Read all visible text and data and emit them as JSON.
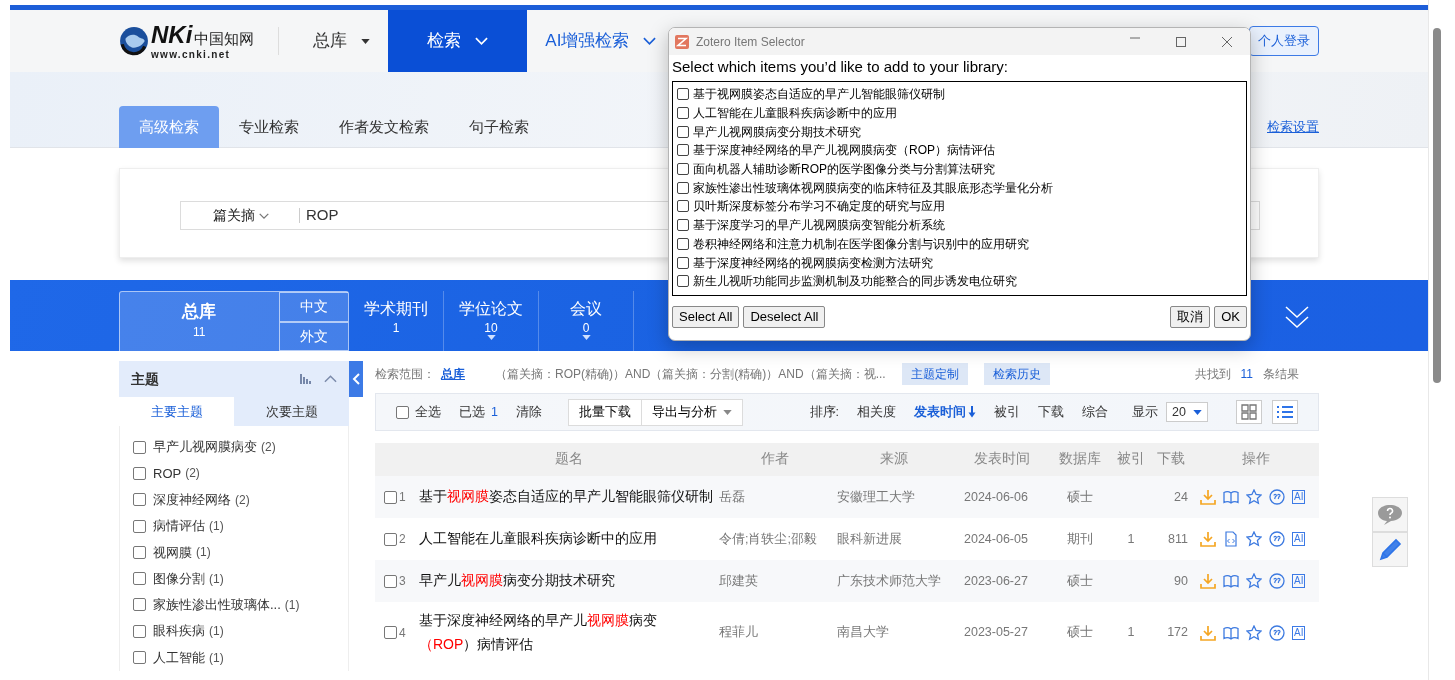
{
  "header": {
    "logo": {
      "mark": "NKi",
      "name": "中国知网",
      "url": "www.cnki.net"
    },
    "nav": [
      {
        "label": "总库",
        "kind": "dropdown",
        "selected": false
      },
      {
        "label": "检索",
        "kind": "menu",
        "selected": true
      },
      {
        "label": "AI增强检索",
        "kind": "menu",
        "selected": false
      }
    ],
    "login_button": "个人登录"
  },
  "search_tabs": [
    {
      "label": "高级检索",
      "selected": true
    },
    {
      "label": "专业检索",
      "selected": false
    },
    {
      "label": "作者发文检索",
      "selected": false
    },
    {
      "label": "句子检索",
      "selected": false
    }
  ],
  "search_settings_link": "检索设置",
  "search_row": {
    "field": "篇关摘",
    "value": "ROP"
  },
  "databases": {
    "all": {
      "label": "总库",
      "count": "11",
      "selected": true
    },
    "languages": [
      {
        "label": "中文"
      },
      {
        "label": "外文"
      }
    ],
    "items": [
      {
        "label": "学术期刊",
        "count": "1",
        "expandable": false
      },
      {
        "label": "学位论文",
        "count": "10",
        "expandable": true
      },
      {
        "label": "会议",
        "count": "0",
        "expandable": true
      }
    ]
  },
  "sidebar": {
    "title": "主题",
    "subtabs": [
      {
        "label": "主要主题",
        "selected": true
      },
      {
        "label": "次要主题",
        "selected": false
      }
    ],
    "items": [
      {
        "label": "早产儿视网膜病变",
        "count": "(2)",
        "checked": false
      },
      {
        "label": "ROP",
        "count": "(2)",
        "checked": false
      },
      {
        "label": "深度神经网络",
        "count": "(2)",
        "checked": false
      },
      {
        "label": "病情评估",
        "count": "(1)",
        "checked": false
      },
      {
        "label": "视网膜",
        "count": "(1)",
        "checked": false
      },
      {
        "label": "图像分割",
        "count": "(1)",
        "checked": false
      },
      {
        "label": "家族性渗出性玻璃体...",
        "count": "(1)",
        "checked": false
      },
      {
        "label": "眼科疾病",
        "count": "(1)",
        "checked": false
      },
      {
        "label": "人工智能",
        "count": "(1)",
        "checked": false
      }
    ]
  },
  "results": {
    "scope_label": "检索范围：",
    "scope": "总库",
    "query": "（篇关摘：ROP(精确)）AND（篇关摘：分割(精确)）AND（篇关摘：视...",
    "topic_button": "主题定制",
    "history_button": "检索历史",
    "found_prefix": "共找到",
    "found_count": "11",
    "found_suffix": "条结果",
    "toolbar": {
      "select_all": {
        "label": "全选",
        "checked": false
      },
      "selected_label": "已选",
      "selected_count": "1",
      "clear": "清除",
      "batch_download": "批量下载",
      "export": "导出与分析",
      "sort_label": "排序:",
      "sort_options": [
        {
          "label": "相关度",
          "selected": false
        },
        {
          "label": "发表时间",
          "selected": true
        },
        {
          "label": "被引",
          "selected": false
        },
        {
          "label": "下载",
          "selected": false
        },
        {
          "label": "综合",
          "selected": false
        }
      ],
      "display_label": "显示",
      "page_size": "20",
      "views": [
        {
          "kind": "grid",
          "selected": false
        },
        {
          "kind": "list",
          "selected": true
        }
      ]
    },
    "columns": [
      "题名",
      "作者",
      "来源",
      "发表时间",
      "数据库",
      "被引",
      "下载",
      "操作"
    ],
    "rows": [
      {
        "checked": false,
        "index": "1",
        "title": [
          {
            "text": "基于",
            "highlight": false
          },
          {
            "text": "视网膜",
            "highlight": true
          },
          {
            "text": "姿态自适应的早产儿智能眼筛仪研制",
            "highlight": false
          }
        ],
        "author": "岳磊",
        "source": "安徽理工大学",
        "date": "2024-06-06",
        "database": "硕士",
        "downloads": "24",
        "kind": "book",
        "ai_label": "AI"
      },
      {
        "checked": false,
        "index": "2",
        "title": [
          {
            "text": "人工智能在儿童眼科疾病诊断中的应用",
            "highlight": false
          }
        ],
        "author": "令倩;肖轶尘;邵毅",
        "source": "眼科新进展",
        "date": "2024-06-05",
        "database": "期刊",
        "cited": "1",
        "downloads": "811",
        "kind": "html",
        "ai_label": "AI"
      },
      {
        "checked": false,
        "index": "3",
        "title": [
          {
            "text": "早产儿",
            "highlight": false
          },
          {
            "text": "视网膜",
            "highlight": true
          },
          {
            "text": "病变分期技术研究",
            "highlight": false
          }
        ],
        "author": "邱建英",
        "source": "广东技术师范大学",
        "date": "2023-06-27",
        "database": "硕士",
        "downloads": "90",
        "kind": "book",
        "ai_label": "AI"
      },
      {
        "checked": false,
        "index": "4",
        "title": [
          {
            "text": "基于深度神经网络的早产儿",
            "highlight": false
          },
          {
            "text": "视网膜",
            "highlight": true
          },
          {
            "text": "病变",
            "highlight": false
          },
          {
            "text": "（ROP",
            "highlight": true
          },
          {
            "text": "）病情评估",
            "highlight": false
          }
        ],
        "author": "程菲儿",
        "source": "南昌大学",
        "date": "2023-05-27",
        "database": "硕士",
        "cited": "1",
        "downloads": "172",
        "kind": "book",
        "ai_label": "AI"
      }
    ]
  },
  "dialog": {
    "title": "Zotero Item Selector",
    "prompt": "Select which items you’d like to add to your library:",
    "items": [
      {
        "label": "基于视网膜姿态自适应的早产儿智能眼筛仪研制",
        "checked": false
      },
      {
        "label": "人工智能在儿童眼科疾病诊断中的应用",
        "checked": false
      },
      {
        "label": "早产儿视网膜病变分期技术研究",
        "checked": false
      },
      {
        "label": "基于深度神经网络的早产儿视网膜病变（ROP）病情评估",
        "checked": false
      },
      {
        "label": "面向机器人辅助诊断ROP的医学图像分类与分割算法研究",
        "checked": false
      },
      {
        "label": "家族性渗出性玻璃体视网膜病变的临床特征及其眼底形态学量化分析",
        "checked": false
      },
      {
        "label": "贝叶斯深度标签分布学习不确定度的研究与应用",
        "checked": false
      },
      {
        "label": "基于深度学习的早产儿视网膜病变智能分析系统",
        "checked": false
      },
      {
        "label": "卷积神经网络和注意力机制在医学图像分割与识别中的应用研究",
        "checked": false
      },
      {
        "label": "基于深度神经网络的视网膜病变检测方法研究",
        "checked": false
      },
      {
        "label": "新生儿视听功能同步监测机制及功能整合的同步诱发电位研究",
        "checked": false
      }
    ],
    "buttons": [
      {
        "label": "Select All",
        "kind": "select"
      },
      {
        "label": "Deselect All",
        "kind": "deselect"
      },
      {
        "label": "取消",
        "kind": "cancel"
      },
      {
        "label": "OK",
        "kind": "ok"
      }
    ]
  }
}
